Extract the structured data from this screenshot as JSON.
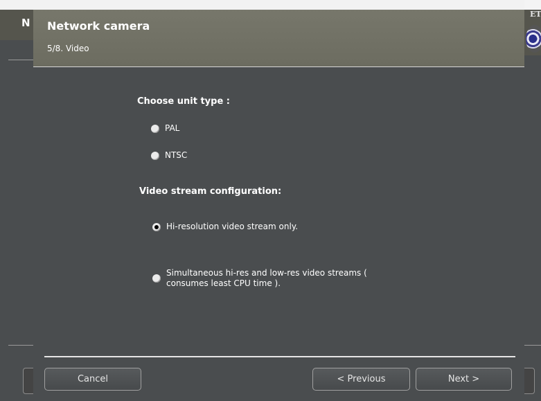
{
  "background": {
    "left_header_letter": "N",
    "right_logo_text": "ET"
  },
  "dialog": {
    "title": "Network camera",
    "step": "5/8. Video"
  },
  "unit_type": {
    "heading": "Choose unit type :",
    "options": [
      {
        "label": "PAL",
        "checked": false
      },
      {
        "label": "NTSC",
        "checked": false
      }
    ]
  },
  "stream_config": {
    "heading": "Video stream configuration:",
    "options": [
      {
        "label": "Hi-resolution video stream only.",
        "checked": true
      },
      {
        "label": "Simultaneous hi-res and low-res video streams ( consumes least CPU time ).",
        "checked": false
      }
    ]
  },
  "buttons": {
    "cancel": "Cancel",
    "previous": "< Previous",
    "next": "Next >"
  }
}
